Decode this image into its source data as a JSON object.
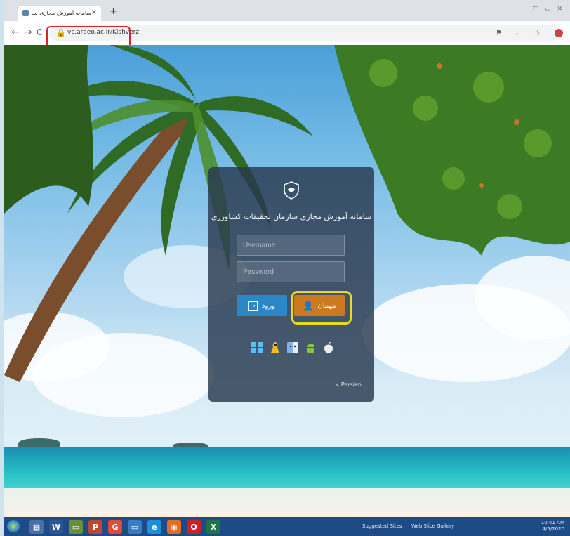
{
  "browser": {
    "tab_title": "سامانه آموزش مجازی سازمان تحقیقات",
    "tab_close": "×",
    "new_tab": "+",
    "window_controls": "▢ ▭ ✕",
    "back": "←",
    "forward": "→",
    "reload": "C",
    "url": "vc.areeo.ac.ir/Kishverzi",
    "toolbar_icons": "⚑ ⌕ ☆"
  },
  "login": {
    "title": "سامانه آموزش مجازی سازمان تحقیقات کشاورزی",
    "username_placeholder": "Username",
    "password_placeholder": "Password",
    "left_button_label": "ورود",
    "right_button_label": "مهمان",
    "platforms": [
      "windows-icon",
      "linux-icon",
      "mac-finder-icon",
      "android-icon",
      "apple-icon"
    ],
    "footer_link": "« Persian"
  },
  "taskbar": {
    "apps": [
      "W",
      "▦",
      "P",
      "G",
      "▭",
      "e",
      "◉",
      "O",
      "X"
    ],
    "item1": "Suggested Sites",
    "item2": "Web Slice Gallery",
    "time": "10:41 AM",
    "date": "4/5/2020"
  },
  "colors": {
    "card_bg": "#28384e",
    "btn_blue": "#2b88c8",
    "btn_orange": "#cc7a22",
    "highlight_red": "#d6262b",
    "highlight_yellow": "#e6dc1c"
  }
}
